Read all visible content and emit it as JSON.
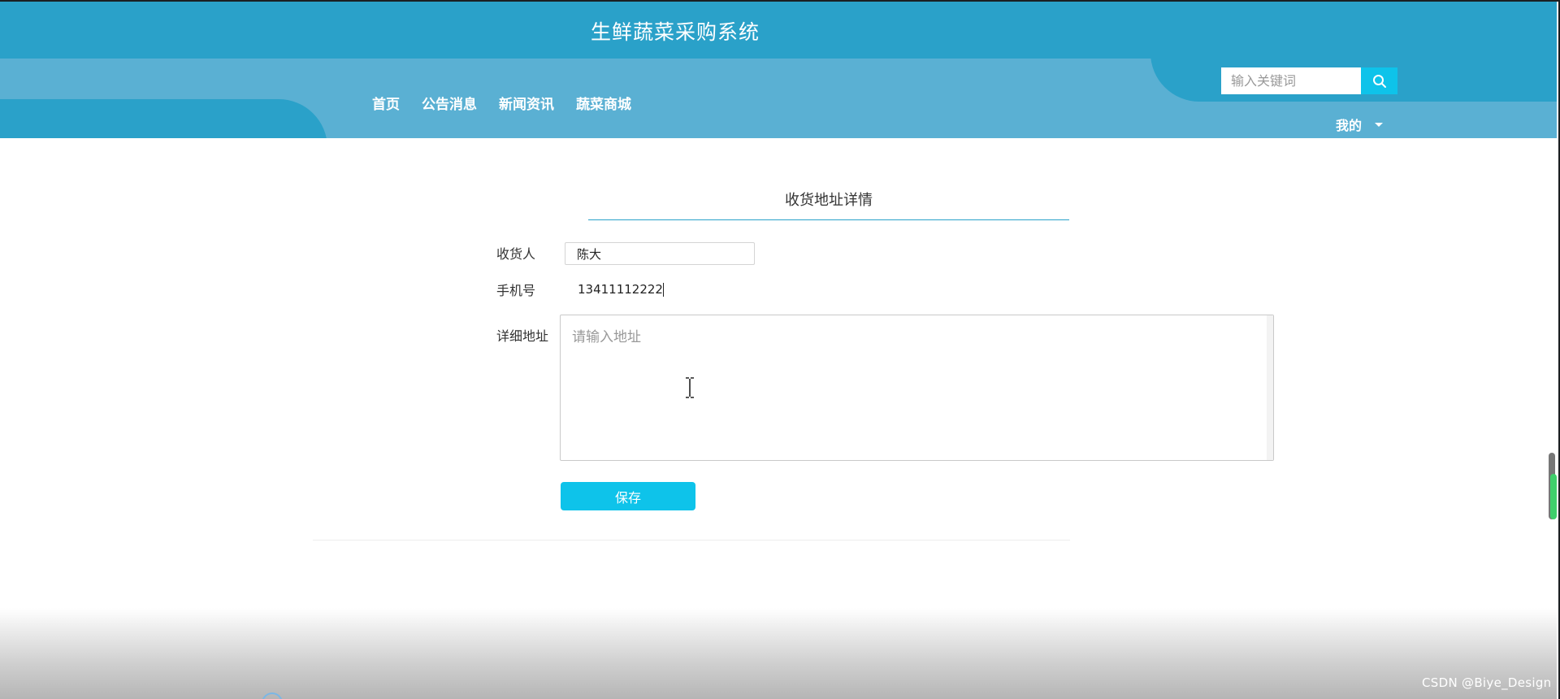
{
  "header": {
    "site_title": "生鲜蔬菜采购系统",
    "nav": [
      "首页",
      "公告消息",
      "新闻资讯",
      "蔬菜商城"
    ],
    "search_placeholder": "输入关键词",
    "user_menu": "我的"
  },
  "form": {
    "title": "收货地址详情",
    "receiver_label": "收货人",
    "receiver_value": "陈大",
    "phone_label": "手机号",
    "phone_value": "13411112222",
    "address_label": "详细地址",
    "address_placeholder": "请输入地址",
    "save_label": "保存"
  },
  "watermark": "CSDN @Biye_Design",
  "colors": {
    "header_dark": "#2aa1c9",
    "header_light": "#5ab0d3",
    "accent": "#0ec3ea"
  }
}
